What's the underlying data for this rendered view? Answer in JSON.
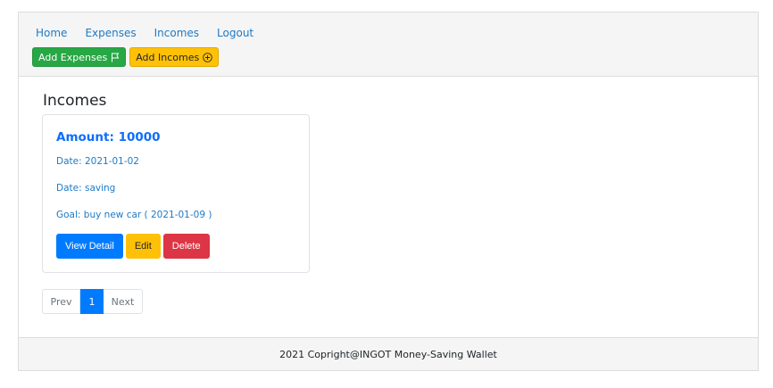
{
  "nav": {
    "items": [
      "Home",
      "Expenses",
      "Incomes",
      "Logout"
    ]
  },
  "actions": {
    "add_expenses": "Add Expenses",
    "add_incomes": "Add Incomes"
  },
  "page_title": "Incomes",
  "card": {
    "amount": "Amount: 10000",
    "date": "Date: 2021-01-02",
    "type": "Date: saving",
    "goal": "Goal: buy new car ( 2021-01-09 )",
    "buttons": {
      "view": "View Detail",
      "edit": "Edit",
      "delete": "Delete"
    }
  },
  "pagination": {
    "prev": "Prev",
    "current": "1",
    "next": "Next"
  },
  "footer": "2021 Copright@INGOT Money-Saving Wallet",
  "colors": {
    "primary": "#007bff",
    "success": "#28a745",
    "warning": "#ffc107",
    "danger": "#dc3545"
  },
  "icons": {
    "add_expenses": "flag-icon",
    "add_incomes": "plus-circle-icon"
  }
}
